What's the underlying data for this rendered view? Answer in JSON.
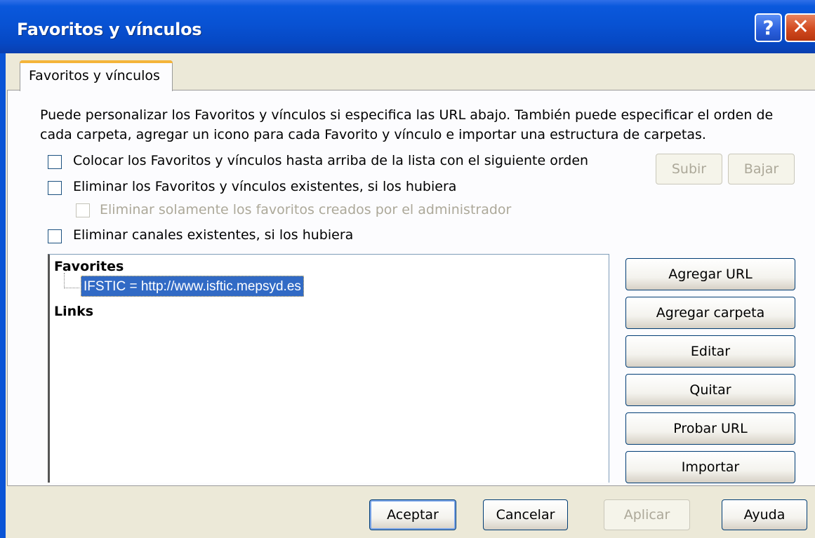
{
  "window": {
    "title": "Favoritos y vínculos"
  },
  "titlebar": {
    "help_label": "?",
    "close_label": "✕"
  },
  "tab": {
    "label": "Favoritos y vínculos"
  },
  "description": {
    "line1": "Puede personalizar los Favoritos y vínculos si especifica las URL abajo. También puede especificar el orden de",
    "line2": "cada carpeta, agregar un icono para cada Favorito y vínculo e importar una estructura de carpetas."
  },
  "options": {
    "place_on_top": "Colocar los Favoritos y vínculos hasta arriba de la lista con el siguiente orden",
    "delete_existing": "Eliminar los Favoritos y vínculos existentes, si los hubiera",
    "delete_admin_only": "Eliminar solamente los favoritos creados por el administrador",
    "delete_channels": "Eliminar canales existentes, si los hubiera"
  },
  "order_buttons": {
    "up": "Subir",
    "down": "Bajar"
  },
  "tree": {
    "root_favorites": "Favorites",
    "selected_item": "IFSTIC = http://www.isftic.mepsyd.es",
    "root_links": "Links"
  },
  "side_buttons": {
    "add_url": "Agregar URL",
    "add_folder": "Agregar carpeta",
    "edit": "Editar",
    "remove": "Quitar",
    "test_url": "Probar URL",
    "import": "Importar"
  },
  "footer": {
    "ok": "Aceptar",
    "cancel": "Cancelar",
    "apply": "Aplicar",
    "help": "Ayuda"
  }
}
